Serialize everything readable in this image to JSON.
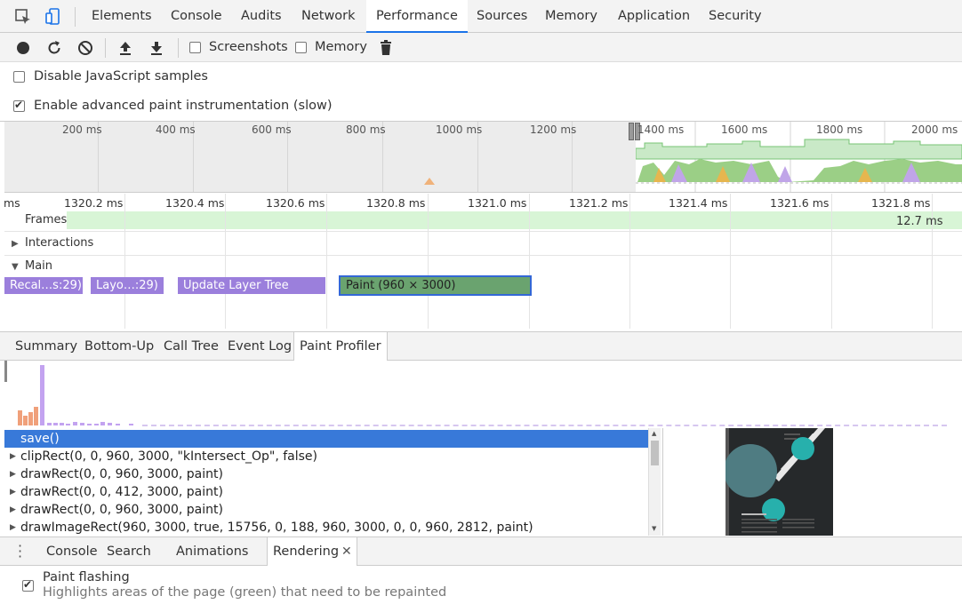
{
  "top_tabs": {
    "inspect_icon": "inspect-element-icon",
    "device_icon": "device-toolbar-icon",
    "items": [
      "Elements",
      "Console",
      "Audits",
      "Network",
      "Performance",
      "Sources",
      "Memory",
      "Application",
      "Security"
    ],
    "active": "Performance",
    "accent_color": "#1a73e8"
  },
  "toolbar": {
    "record_icon": "record-icon",
    "reload_icon": "reload-icon",
    "clear_icon": "clear-icon",
    "upload_icon": "upload-icon",
    "download_icon": "download-icon",
    "screenshots_label": "Screenshots",
    "screenshots_checked": false,
    "memory_label": "Memory",
    "memory_checked": false,
    "trash_icon": "trash-icon"
  },
  "settings": {
    "disable_js_samples_label": "Disable JavaScript samples",
    "disable_js_samples_checked": false,
    "advanced_paint_label": "Enable advanced paint instrumentation (slow)",
    "advanced_paint_checked": true
  },
  "overview": {
    "ticks": [
      "200 ms",
      "400 ms",
      "600 ms",
      "800 ms",
      "1000 ms",
      "1200 ms",
      "1400 ms",
      "1600 ms",
      "1800 ms",
      "2000 ms"
    ]
  },
  "ruler": {
    "edge_label": "ms",
    "labels": [
      "1320.2 ms",
      "1320.4 ms",
      "1320.6 ms",
      "1320.8 ms",
      "1321.0 ms",
      "1321.2 ms",
      "1321.4 ms",
      "1321.6 ms",
      "1321.8 ms"
    ]
  },
  "tracks": {
    "frames_label": "Frames",
    "frames_duration": "12.7 ms",
    "interactions_label": "Interactions",
    "main_label": "Main",
    "events": [
      {
        "label": "Recal…s:29)",
        "color": "#9b7fdc"
      },
      {
        "label": "Layo…:29)",
        "color": "#9b7fdc"
      },
      {
        "label": "Update Layer Tree",
        "color": "#9b7fdc"
      },
      {
        "label": "Paint (960 × 3000)",
        "color": "#6aa36f"
      }
    ]
  },
  "details_tabs": {
    "items": [
      "Summary",
      "Bottom-Up",
      "Call Tree",
      "Event Log",
      "Paint Profiler"
    ],
    "active": "Paint Profiler"
  },
  "paint_profiler": {
    "commands": [
      "save()",
      "clipRect(0, 0, 960, 3000, \"kIntersect_Op\", false)",
      "drawRect(0, 0, 960, 3000, paint)",
      "drawRect(0, 0, 412, 3000, paint)",
      "drawRect(0, 0, 960, 3000, paint)",
      "drawImageRect(960, 3000, true, 15756, 0, 188, 960, 3000, 0, 0, 960, 2812, paint)"
    ],
    "selected_index": 0,
    "selected_color": "#3879d9"
  },
  "drawer": {
    "menu_icon": "more-vertical-icon",
    "tabs": [
      "Console",
      "Search",
      "Animations",
      "Rendering"
    ],
    "active": "Rendering",
    "close_icon": "close-icon",
    "paint_flashing_label": "Paint flashing",
    "paint_flashing_checked": true,
    "paint_flashing_desc": "Highlights areas of the page (green) that need to be repainted"
  }
}
